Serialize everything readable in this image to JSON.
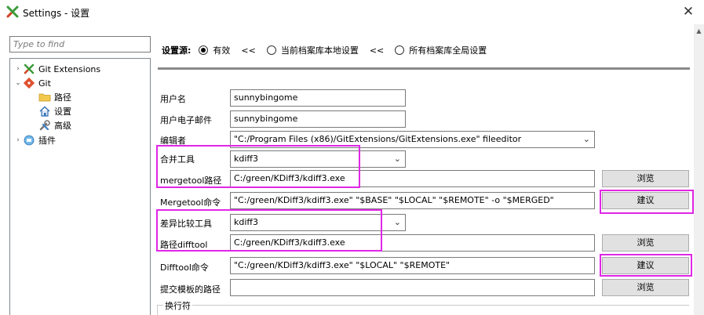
{
  "window": {
    "title": "Settings - 设置",
    "close_glyph": "✕"
  },
  "colors": {
    "highlight": "#e026e6",
    "button_bg": "#e1e1e1"
  },
  "filter": {
    "placeholder": "Type to find"
  },
  "tree": [
    {
      "label": "Git Extensions",
      "icon": "git-extensions-icon",
      "expander": "›"
    },
    {
      "label": "Git",
      "icon": "git-icon",
      "expander": "⌄"
    },
    {
      "label": "路径",
      "icon": "folder-icon"
    },
    {
      "label": "设置",
      "icon": "home-icon"
    },
    {
      "label": "高级",
      "icon": "tools-icon"
    },
    {
      "label": "插件",
      "icon": "plugin-icon",
      "expander": "›"
    }
  ],
  "settings_source": {
    "label": "设置源:",
    "separator": "<<",
    "options": [
      {
        "label": "有效",
        "selected": true
      },
      {
        "label": "当前档案库本地设置",
        "selected": false
      },
      {
        "label": "所有档案库全局设置",
        "selected": false
      }
    ]
  },
  "form": {
    "username": {
      "label": "用户名",
      "value": "sunnybingome"
    },
    "email": {
      "label": "用户电子邮件",
      "value": "sunnybingome"
    },
    "editor": {
      "label": "编辑者",
      "value": "\"C:/Program Files (x86)/GitExtensions/GitExtensions.exe\" fileeditor"
    },
    "mergetool": {
      "label": "合并工具",
      "value": "kdiff3"
    },
    "mergetool_path": {
      "label": "mergetool路径",
      "value": "C:/green/KDiff3/kdiff3.exe",
      "button": "浏览"
    },
    "mergetool_cmd": {
      "label": "Mergetool命令",
      "value": "\"C:/green/KDiff3/kdiff3.exe\" \"$BASE\" \"$LOCAL\" \"$REMOTE\" -o \"$MERGED\"",
      "button": "建议"
    },
    "difftool": {
      "label": "差异比较工具",
      "value": "kdiff3"
    },
    "difftool_path": {
      "label": "路径difftool",
      "value": "C:/green/KDiff3/kdiff3.exe",
      "button": "浏览"
    },
    "difftool_cmd": {
      "label": "Difftool命令",
      "value": "\"C:/green/KDiff3/kdiff3.exe\" \"$LOCAL\" \"$REMOTE\"",
      "button": "建议"
    },
    "commit_template": {
      "label": "提交模板的路径",
      "button": "浏览"
    },
    "line_endings_group": {
      "label": "换行符"
    }
  },
  "combo_arrow": "⌄"
}
